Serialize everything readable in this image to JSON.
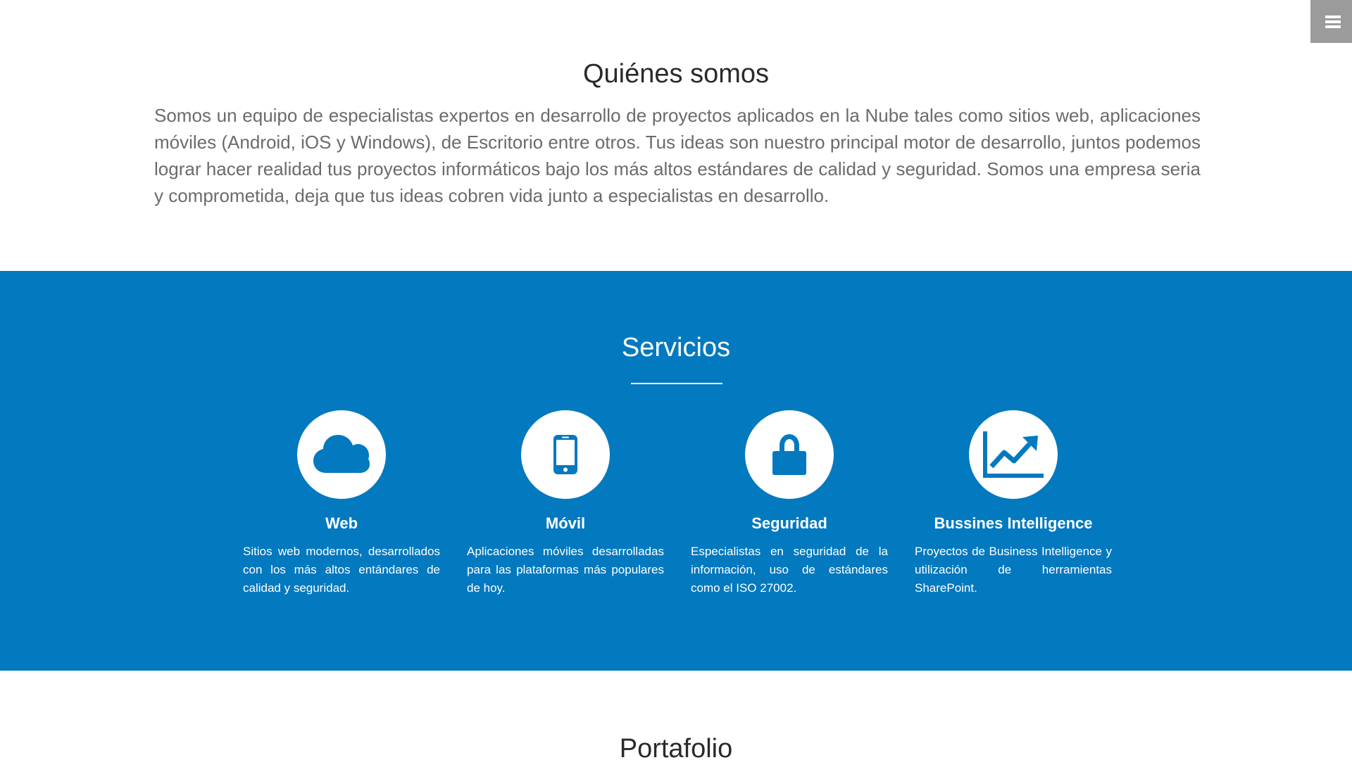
{
  "nav": {
    "menu_icon": "hamburger-menu-icon",
    "menu_bg": "#9b9b9b"
  },
  "about": {
    "title": "Quiénes somos",
    "text": "Somos un equipo de especialistas expertos en desarrollo de proyectos aplicados en la Nube tales como sitios web, aplicaciones móviles (Android, iOS y Windows), de Escritorio entre otros. Tus ideas son nuestro principal motor de desarrollo, juntos podemos lograr hacer realidad tus proyectos informáticos bajo los más altos estándares de calidad y seguridad. Somos una empresa seria y comprometida, deja que tus ideas cobren vida junto a especialistas en desarrollo."
  },
  "services": {
    "title": "Servicios",
    "bg_color": "#0379bf",
    "items": [
      {
        "icon": "cloud-icon",
        "name": "Web",
        "description": "Sitios web modernos, desarrollados con los más altos entándares de calidad y seguridad."
      },
      {
        "icon": "mobile-phone-icon",
        "name": "Móvil",
        "description": "Aplicaciones móviles desarrolladas para las plataformas más populares de hoy."
      },
      {
        "icon": "lock-icon",
        "name": "Seguridad",
        "description": "Especialistas en seguridad de la información, uso de estándares como el ISO 27002."
      },
      {
        "icon": "line-chart-icon",
        "name": "Bussines Intelligence",
        "description": "Proyectos de Business Intelligence y utilización de herramientas SharePoint."
      }
    ]
  },
  "portfolio": {
    "title": "Portafolio"
  }
}
